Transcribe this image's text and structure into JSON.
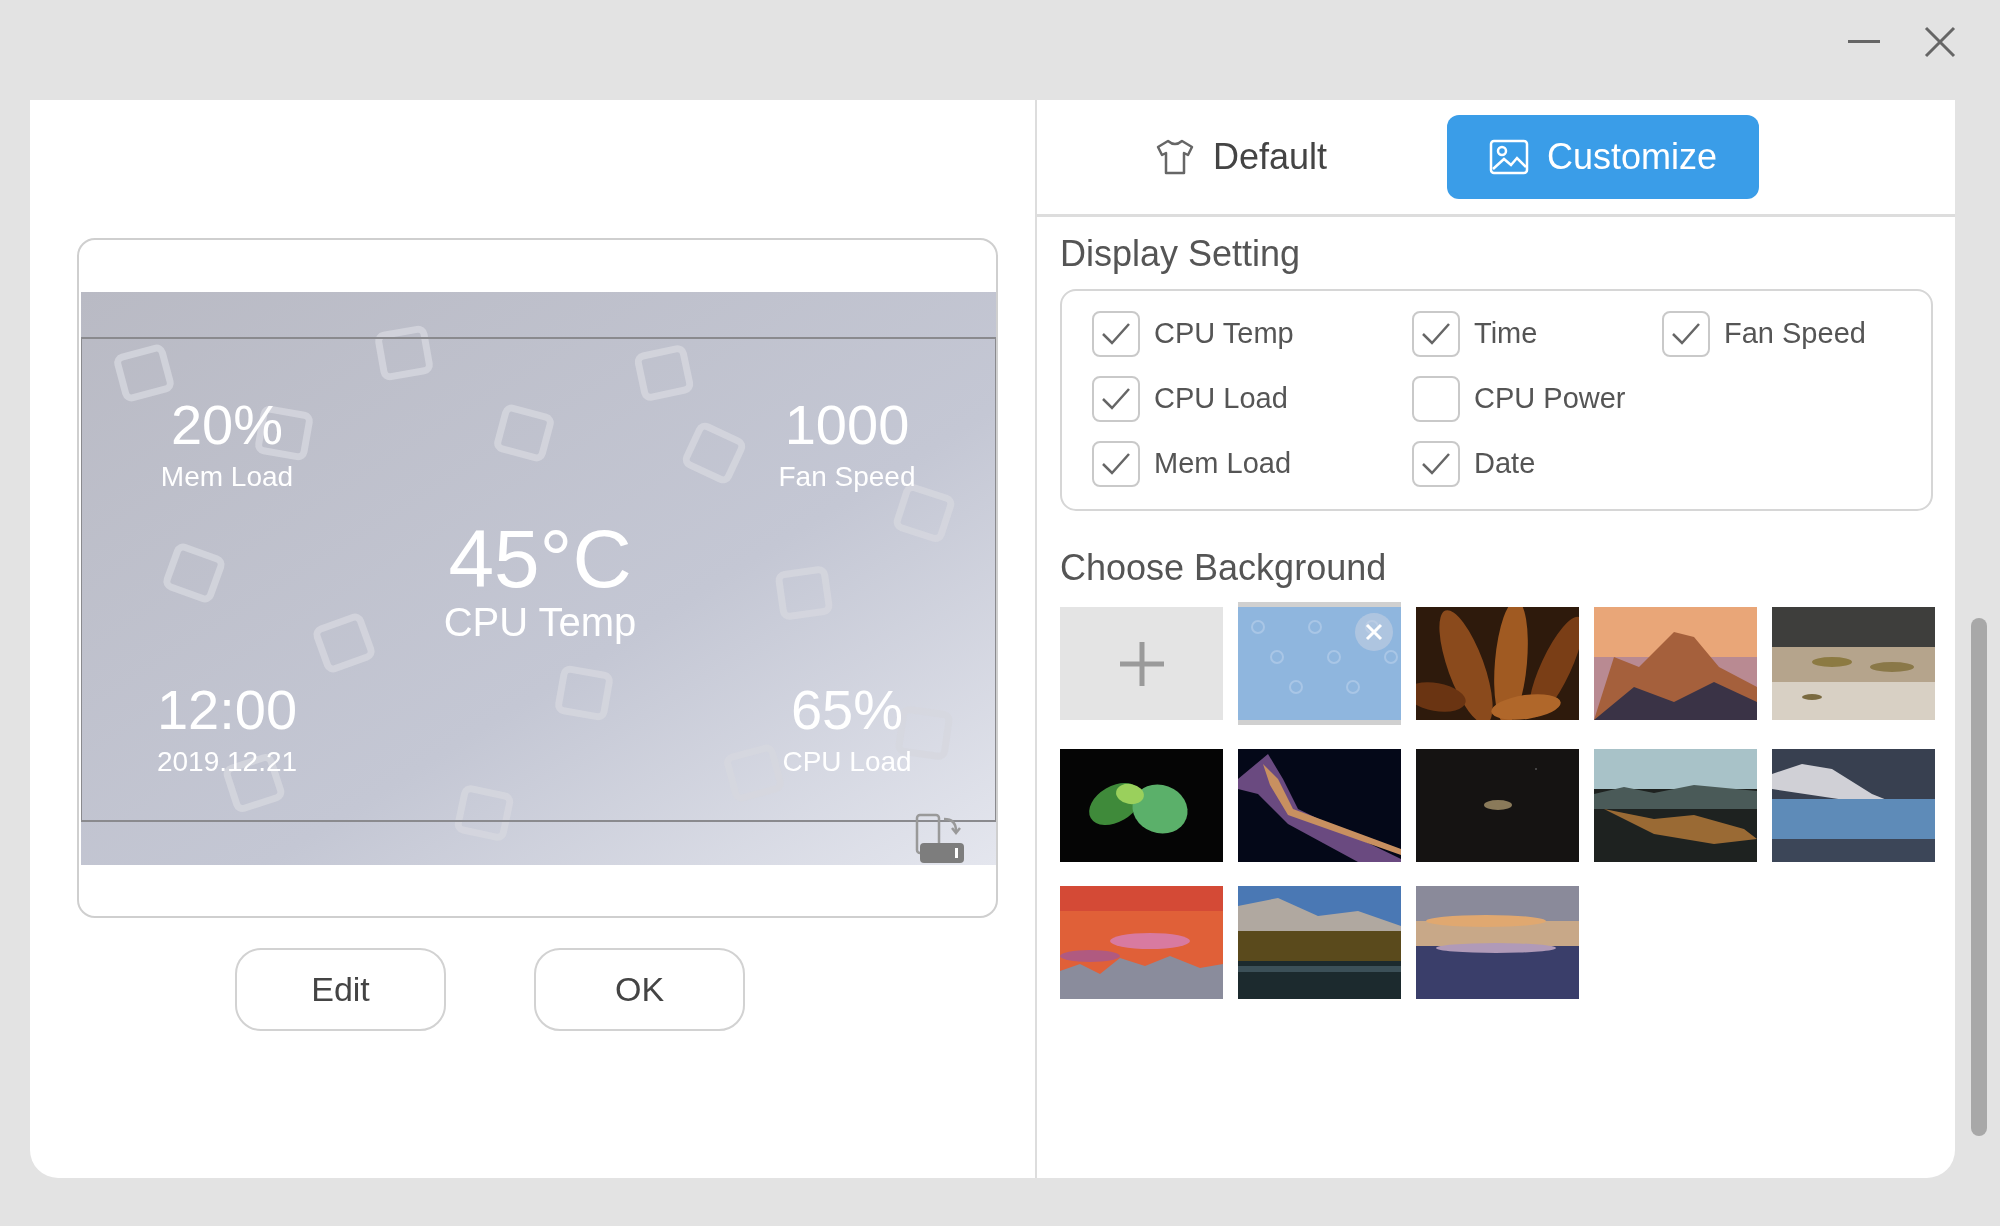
{
  "tabs": [
    {
      "label": "Default",
      "selected": false
    },
    {
      "label": "Customize",
      "selected": true
    }
  ],
  "preview": {
    "top_left": {
      "value": "20%",
      "label": "Mem Load"
    },
    "top_right": {
      "value": "1000",
      "label": "Fan Speed"
    },
    "center": {
      "value": "45°C",
      "label": "CPU Temp"
    },
    "bottom_left": {
      "value": "12:00",
      "label": "2019.12.21"
    },
    "bottom_right": {
      "value": "65%",
      "label": "CPU Load"
    }
  },
  "buttons": [
    "Edit",
    "OK"
  ],
  "display_setting": {
    "title": "Display Setting",
    "options": [
      {
        "label": "CPU Temp",
        "checked": true
      },
      {
        "label": "CPU Load",
        "checked": true
      },
      {
        "label": "Mem Load",
        "checked": true
      },
      {
        "label": "Time",
        "checked": true
      },
      {
        "label": "CPU Power",
        "checked": false
      },
      {
        "label": "Date",
        "checked": true
      },
      {
        "label": "Fan Speed",
        "checked": true
      }
    ]
  },
  "choose_background": {
    "title": "Choose Background",
    "items": [
      {
        "kind": "add"
      },
      {
        "kind": "picture",
        "selected": true
      },
      {
        "kind": "picture",
        "selected": false
      },
      {
        "kind": "picture",
        "selected": false
      },
      {
        "kind": "picture",
        "selected": false
      },
      {
        "kind": "picture",
        "selected": false
      },
      {
        "kind": "picture",
        "selected": false
      },
      {
        "kind": "picture",
        "selected": false
      },
      {
        "kind": "picture",
        "selected": false
      },
      {
        "kind": "picture",
        "selected": false
      },
      {
        "kind": "picture",
        "selected": false
      },
      {
        "kind": "picture",
        "selected": false
      },
      {
        "kind": "picture",
        "selected": false
      }
    ]
  }
}
